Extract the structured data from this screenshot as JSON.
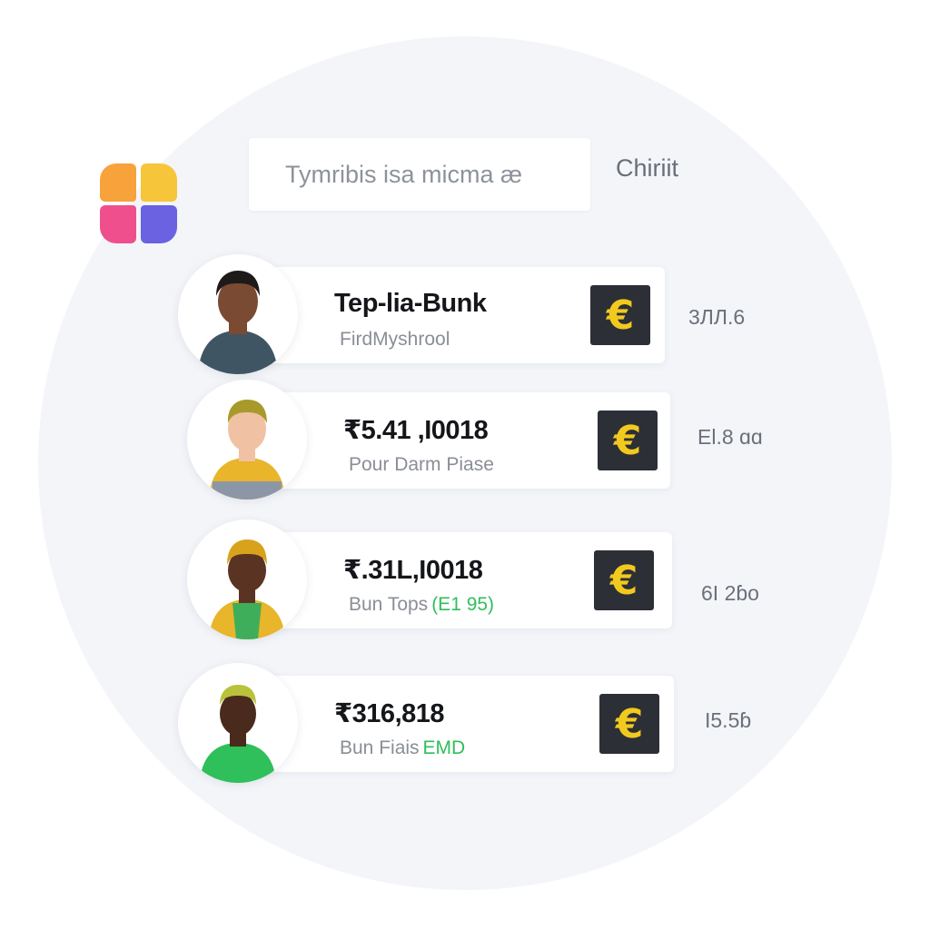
{
  "colors": {
    "background_circle": "#f3f5f9",
    "card": "#ffffff",
    "euro_button_bg": "#2c2f36",
    "euro_button_fg": "#f2c91e",
    "accent_green": "#2fbf5b",
    "logo": [
      "#f7a23b",
      "#f6c53a",
      "#ef4f8c",
      "#6a62e0"
    ]
  },
  "search": {
    "placeholder": "Tymribis isa micma æ"
  },
  "header": {
    "label": "Chiriit"
  },
  "icons": {
    "logo": "app-logo-icon",
    "currency": "euro-icon"
  },
  "rows": [
    {
      "title": "Tep-lia-Bunk",
      "subtitle": "FirdMyshrool",
      "subtitle_extra": "",
      "currency_symbol": "€",
      "side_value": "3ЛЛ.6"
    },
    {
      "title": "₹5.41 ,I0018",
      "subtitle": "Pour Darm Piase",
      "subtitle_extra": "",
      "currency_symbol": "€",
      "side_value": "El.8 ɑɑ"
    },
    {
      "title": "₹.31L,I0018",
      "subtitle": "Bun Tops",
      "subtitle_extra": "(E1 95)",
      "currency_symbol": "€",
      "side_value": "6I 2ɓo"
    },
    {
      "title": "₹316,818",
      "subtitle": "Bun Fiais",
      "subtitle_extra": "EMD",
      "currency_symbol": "€",
      "side_value": "I5.5ɓ"
    }
  ]
}
